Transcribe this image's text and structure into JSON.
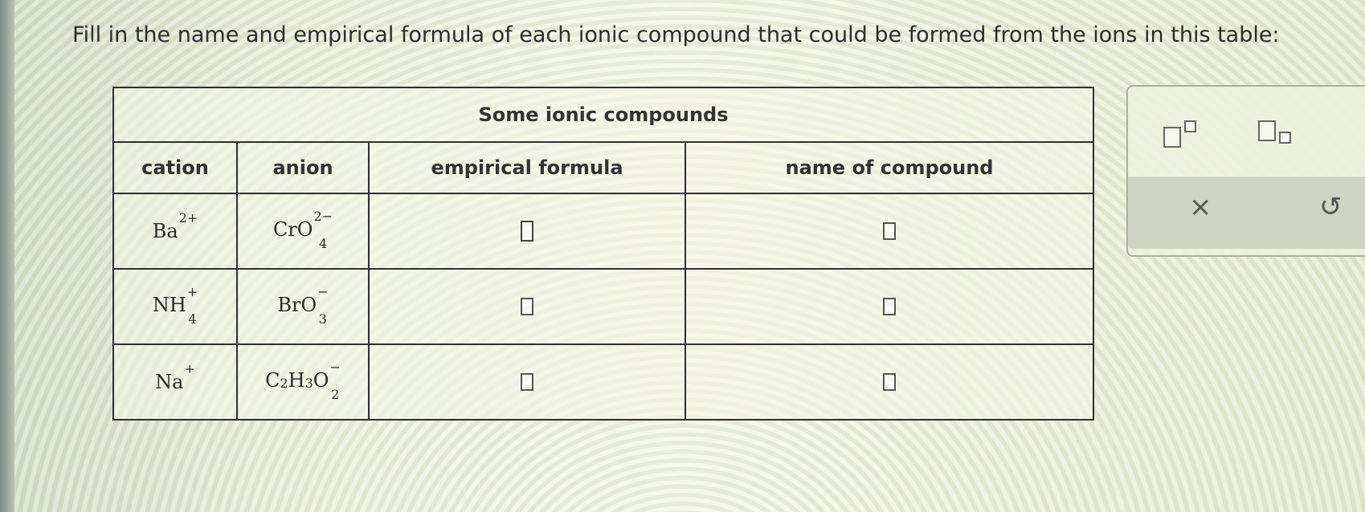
{
  "question": "Fill in the name and empirical formula of each ionic compound that could be formed from the ions in this table:",
  "table": {
    "caption": "Some ionic compounds",
    "headers": [
      "cation",
      "anion",
      "empirical formula",
      "name of compound"
    ],
    "rows": [
      {
        "cation": {
          "base": "Ba",
          "sup": "2+",
          "sub": ""
        },
        "anion": {
          "base": "CrO",
          "sup": "2−",
          "sub": "4"
        },
        "formula_value": "",
        "name_value": ""
      },
      {
        "cation": {
          "base": "NH",
          "sup": "+",
          "sub": "4"
        },
        "anion": {
          "base": "BrO",
          "sup": "−",
          "sub": "3"
        },
        "formula_value": "",
        "name_value": ""
      },
      {
        "cation": {
          "base": "Na",
          "sup": "+",
          "sub": ""
        },
        "anion": {
          "base": "C",
          "sub1": "2",
          "mid": "H",
          "sub2": "3",
          "base2": "O",
          "sup": "−",
          "sub": "2"
        },
        "formula_value": "",
        "name_value": ""
      }
    ]
  },
  "palette": {
    "superscript_icon": "superscript-template-icon",
    "subscript_icon": "subscript-template-icon",
    "clear_label": "×",
    "undo_label": "↺"
  }
}
